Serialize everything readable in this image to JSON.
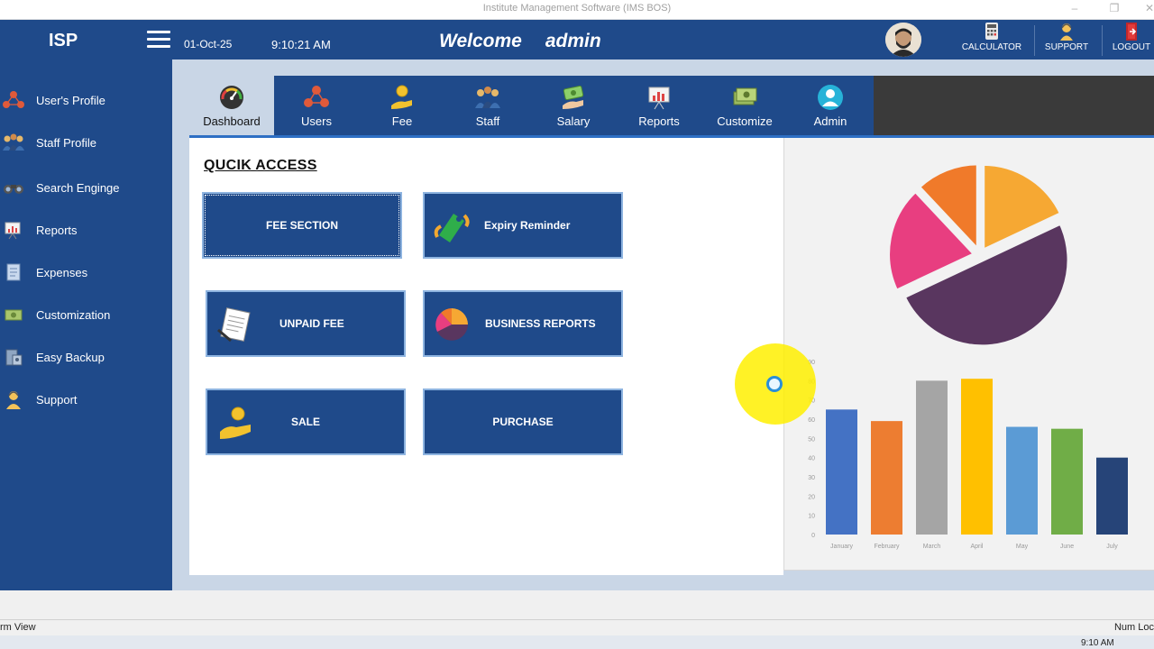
{
  "window": {
    "title": "Institute Management Software (IMS BOS)"
  },
  "header": {
    "brand": "ISP",
    "date": "01-Oct-25",
    "time": "9:10:21 AM",
    "welcome": "Welcome",
    "username": "admin",
    "buttons": [
      {
        "label": "CALCULATOR",
        "icon": "calculator-icon"
      },
      {
        "label": "SUPPORT",
        "icon": "support-icon"
      },
      {
        "label": "LOGOUT",
        "icon": "logout-icon"
      }
    ]
  },
  "sidebar": {
    "items": [
      {
        "label": "User's Profile",
        "icon": "users-network-icon"
      },
      {
        "label": "Staff Profile",
        "icon": "staff-group-icon"
      },
      {
        "label": "Search Enginge",
        "icon": "binoculars-icon"
      },
      {
        "label": "Reports",
        "icon": "report-board-icon"
      },
      {
        "label": "Expenses",
        "icon": "expenses-icon"
      },
      {
        "label": "Customization",
        "icon": "money-icon"
      },
      {
        "label": "Easy Backup",
        "icon": "backup-icon"
      },
      {
        "label": "Support",
        "icon": "support-person-icon"
      }
    ]
  },
  "tabs": [
    {
      "label": "Dashboard",
      "icon": "gauge-icon",
      "active": true
    },
    {
      "label": "Users",
      "icon": "users-network-icon"
    },
    {
      "label": "Fee",
      "icon": "coin-hand-icon"
    },
    {
      "label": "Staff",
      "icon": "staff-group-icon"
    },
    {
      "label": "Salary",
      "icon": "cash-hand-icon"
    },
    {
      "label": "Reports",
      "icon": "report-board-icon"
    },
    {
      "label": "Customize",
      "icon": "money-bundle-icon"
    },
    {
      "label": "Admin",
      "icon": "admin-avatar-icon"
    }
  ],
  "quick_access": {
    "title": "QUCIK ACCESS",
    "buttons": [
      {
        "label": "FEE SECTION",
        "icon": ""
      },
      {
        "label": "Expiry Reminder",
        "icon": "tag-icon"
      },
      {
        "label": "UNPAID FEE",
        "icon": "notepad-icon"
      },
      {
        "label": "BUSINESS REPORTS",
        "icon": "pie-chart-icon"
      },
      {
        "label": "SALE",
        "icon": "coin-hand-icon"
      },
      {
        "label": "PURCHASE",
        "icon": ""
      }
    ]
  },
  "colors": {
    "primary": "#1f4a8a",
    "panel": "#c9d6e6",
    "accent_line": "#2e6fc4"
  },
  "chart_data": [
    {
      "type": "pie",
      "title": "",
      "values": [
        12,
        18,
        50,
        20
      ],
      "colors": [
        "#f07a2a",
        "#f6a833",
        "#59365f",
        "#e83e80"
      ]
    },
    {
      "type": "bar",
      "title": "",
      "categories": [
        "January",
        "February",
        "March",
        "April",
        "May",
        "June",
        "July"
      ],
      "values": [
        65,
        59,
        80,
        81,
        56,
        55,
        40
      ],
      "colors": [
        "#4472c4",
        "#ed7d31",
        "#a5a5a5",
        "#ffc000",
        "#5b9bd5",
        "#70ad47",
        "#264478"
      ],
      "yticks": [
        0,
        10,
        20,
        30,
        40,
        50,
        60,
        70,
        80,
        90
      ],
      "ylim": [
        0,
        90
      ]
    }
  ],
  "statusbar": {
    "left": "rm View",
    "right": "Num Loc"
  },
  "taskbar": {
    "time": "9:10 AM"
  }
}
